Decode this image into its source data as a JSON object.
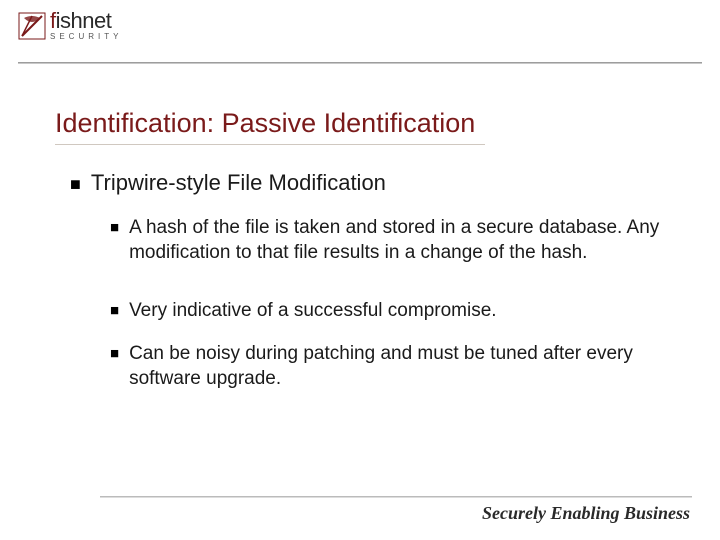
{
  "logo": {
    "main_prefix": "f",
    "main_rest": "ishnet",
    "sub": "SECURITY"
  },
  "title": "Identification: Passive Identification",
  "content": {
    "heading": "Tripwire-style File Modification",
    "sub": [
      "A hash of the file is taken and stored in a secure database. Any modification to that file results in a change of the hash.",
      "Very indicative of a successful compromise.",
      "Can be noisy during patching and must be tuned after every software upgrade."
    ]
  },
  "tagline": "Securely Enabling Business"
}
